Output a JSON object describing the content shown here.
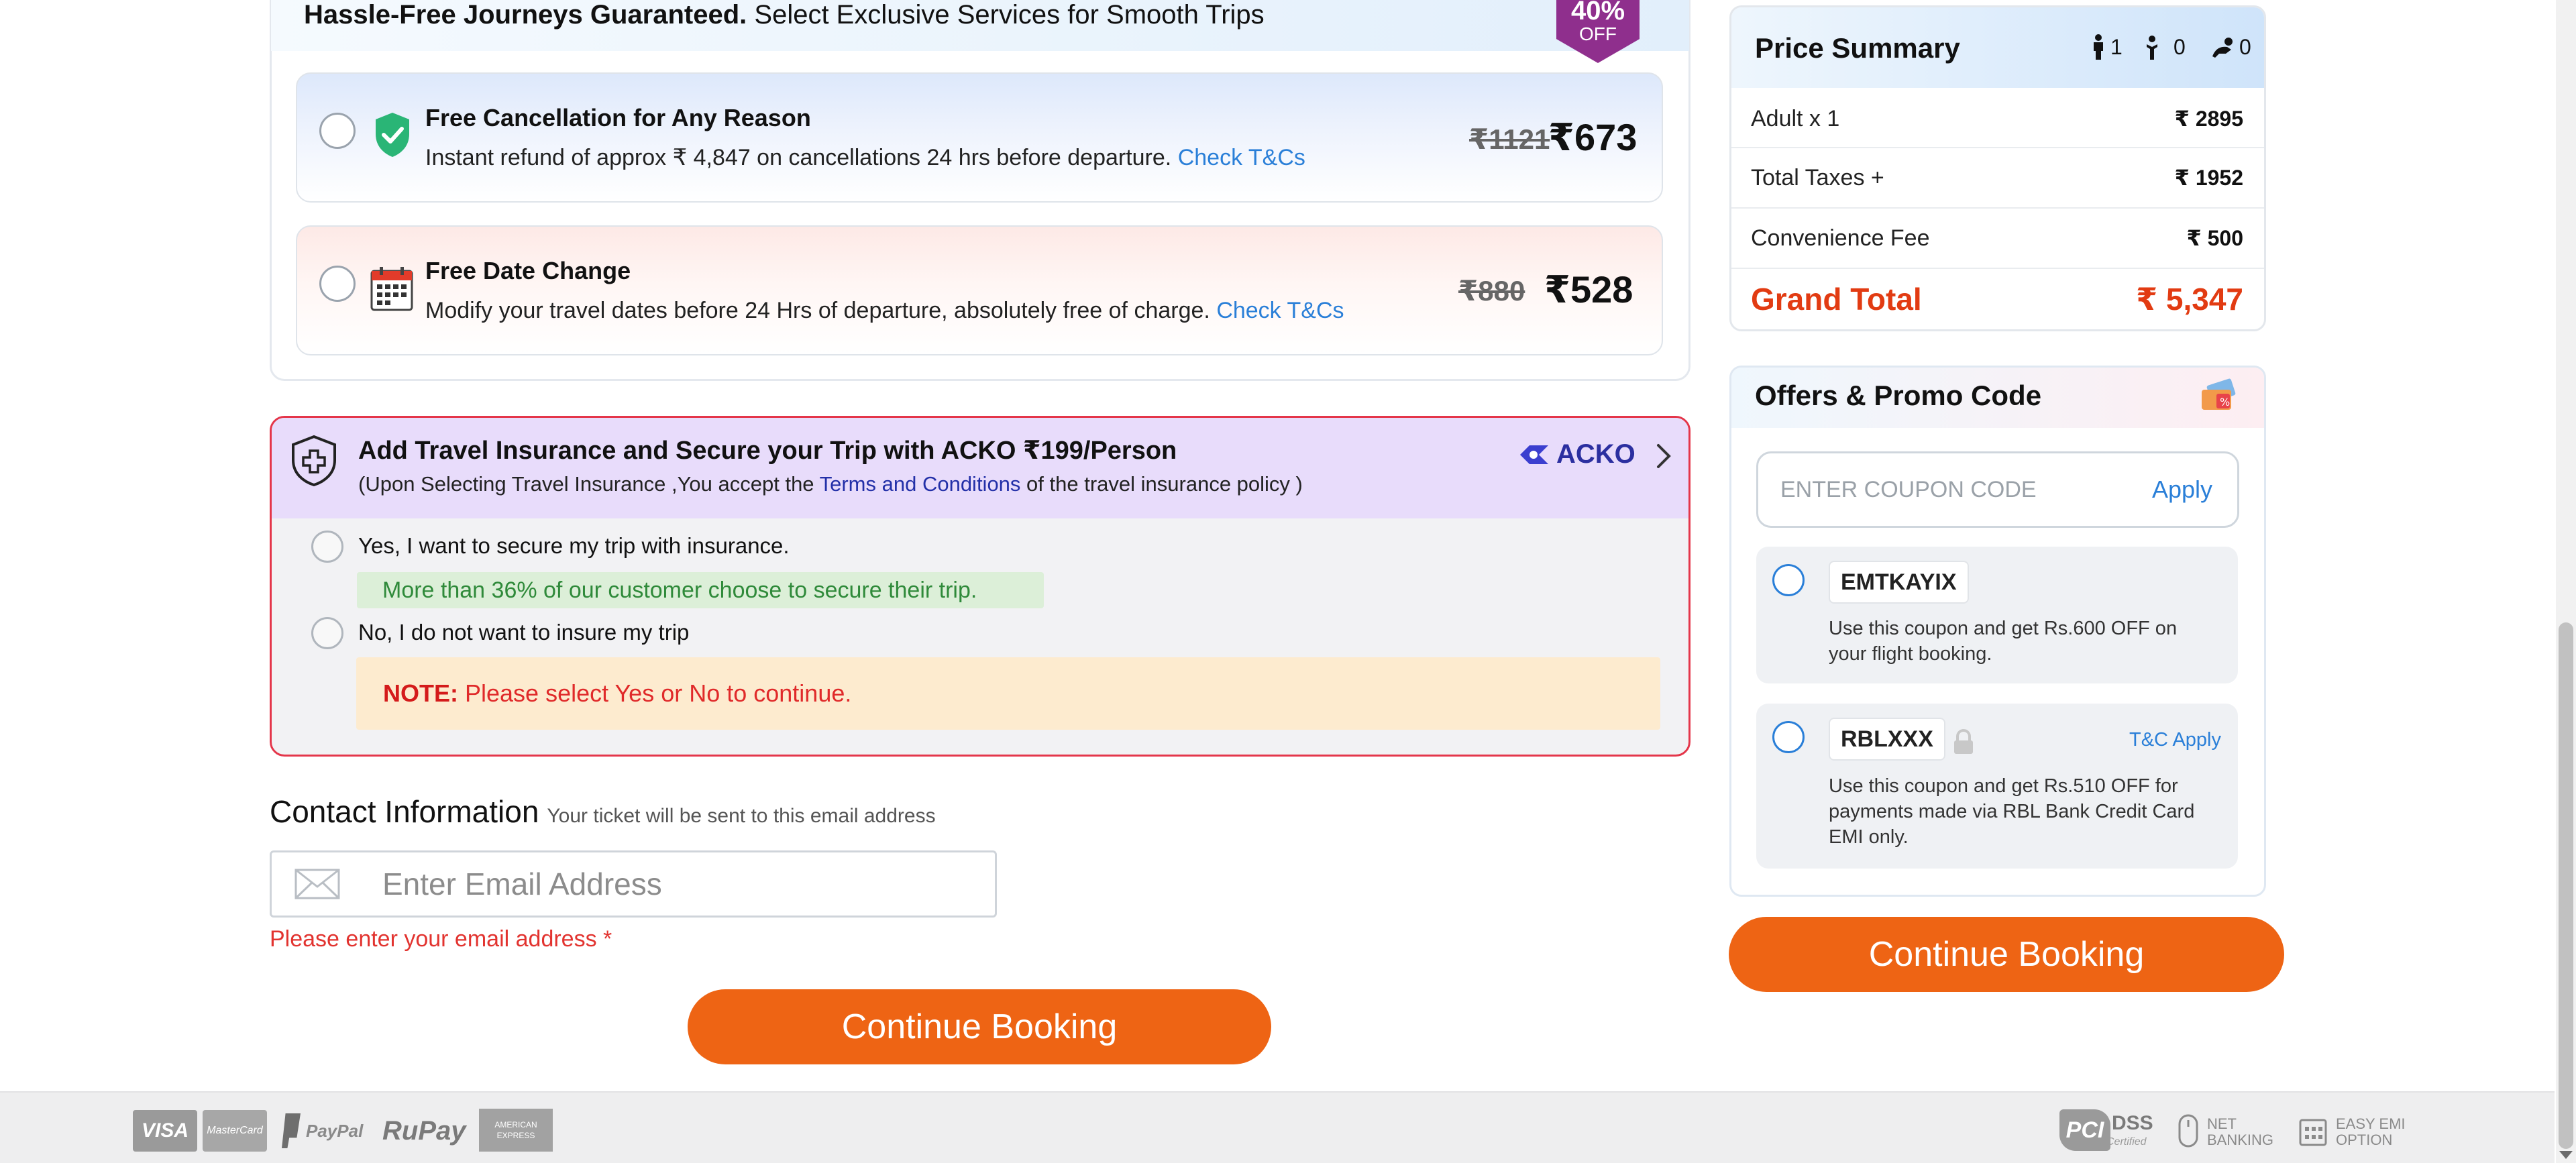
{
  "addons": {
    "banner_bold": "Hassle-Free Journeys Guaranteed.",
    "banner_rest": " Select Exclusive Services for Smooth Trips",
    "badge_pct": "40%",
    "badge_off": "OFF",
    "options": [
      {
        "title": "Free Cancellation for Any Reason",
        "desc": "Instant refund of approx ₹ 4,847 on cancellations 24 hrs before departure.",
        "link": "Check T&Cs",
        "old_price": "₹1121",
        "price": "₹673"
      },
      {
        "title": "Free Date Change",
        "desc": "Modify your travel dates before 24 Hrs of departure, absolutely free of charge.",
        "link": "Check T&Cs",
        "old_price": "₹880",
        "price": "₹528"
      }
    ]
  },
  "insurance": {
    "title_prefix": "Add Travel Insurance and Secure your Trip with ACKO ",
    "price": "₹199",
    "per": "/Person",
    "sub_prefix": "(Upon Selecting Travel Insurance ,You accept the ",
    "sub_link": "Terms and Conditions",
    "sub_suffix": " of the travel insurance policy )",
    "brand": "ACKO",
    "yes_label": "Yes, I want to secure my trip with insurance.",
    "social_proof": "More than 36% of our customer choose to secure their trip.",
    "no_label": "No, I do not want to insure my trip",
    "note_label": "NOTE:",
    "note_text": " Please select Yes or No to continue."
  },
  "contact": {
    "title": "Contact Information",
    "subtitle": "Your ticket will be sent to this email address",
    "email_placeholder": "Enter Email Address",
    "email_value": "",
    "error": "Please enter your email address *"
  },
  "buttons": {
    "continue_left": "Continue Booking",
    "continue_right": "Continue Booking"
  },
  "price_summary": {
    "title": "Price Summary",
    "adults": "1",
    "children": "0",
    "infants": "0",
    "rows": [
      {
        "label": "Adult x 1",
        "value": "₹ 2895"
      },
      {
        "label": "Total Taxes +",
        "value": "₹ 1952"
      },
      {
        "label": "Convenience Fee",
        "value": "₹ 500"
      }
    ],
    "grand_label": "Grand Total",
    "grand_value": "₹ 5,347"
  },
  "offers": {
    "title": "Offers & Promo Code",
    "coupon_placeholder": "ENTER COUPON CODE",
    "apply": "Apply",
    "coupons": [
      {
        "code": "EMTKAYIX",
        "desc": "Use this coupon and get Rs.600 OFF on your flight booking.",
        "tc": ""
      },
      {
        "code": "RBLXXX",
        "desc": "Use this coupon and get Rs.510 OFF for payments made via RBL Bank Credit Card EMI only.",
        "tc": "T&C Apply"
      }
    ]
  },
  "footer": {
    "payments": [
      "VISA",
      "MasterCard",
      "PayPal",
      "RuPay",
      "AMERICAN EXPRESS"
    ],
    "badges": {
      "pci": "PCI",
      "dss": "DSS",
      "certified": "Certified",
      "net1": "NET",
      "net2": "BANKING",
      "emi1": "EASY EMI",
      "emi2": "OPTION"
    }
  },
  "colors": {
    "accent_orange": "#ee6414",
    "grand_total_red": "#e23b12",
    "link_blue": "#2a7fd8",
    "error_red": "#e2332f",
    "insurance_border": "#e4364a"
  }
}
